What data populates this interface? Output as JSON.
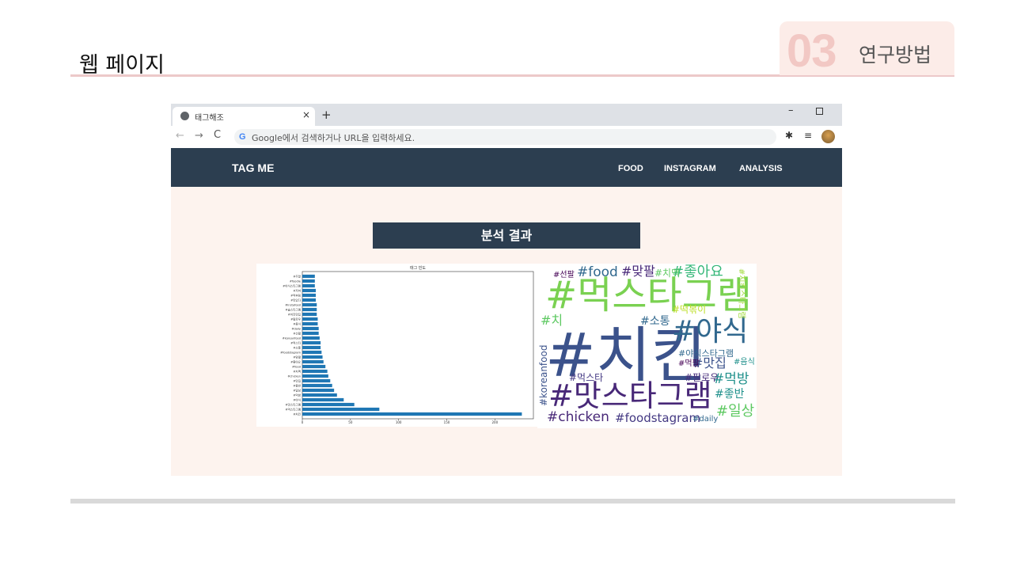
{
  "slide": {
    "title": "웹 페이지",
    "section_number": "03",
    "section_label": "연구방법"
  },
  "browser": {
    "tab_title": "태그해조",
    "tab_close": "×",
    "new_tab": "+",
    "minimize": "–",
    "back": "←",
    "forward": "→",
    "reload": "C",
    "google_g": "G",
    "address_placeholder": "Google에서 검색하거나 URL을 입력하세요.",
    "icons": [
      "globe-icon",
      "puzzle-icon",
      "queue-icon",
      "avatar"
    ]
  },
  "site": {
    "brand": "TAG ME",
    "nav": [
      "FOOD",
      "INSTAGRAM",
      "ANALYSIS"
    ],
    "result_heading": "분석 결과"
  },
  "chart_data": {
    "type": "bar",
    "orientation": "horizontal",
    "title": "태그 빈도",
    "categories": [
      "#치킨",
      "#먹스타그램",
      "#맛스타그램",
      "#야식",
      "#먹방",
      "#일상",
      "#좋반",
      "#맛집",
      "#chicken",
      "#치맥",
      "#food",
      "#좋아요",
      "#맞팔",
      "#foodstagram",
      "#소통",
      "#먹스타",
      "#koreanfood",
      "#선팔",
      "#daily",
      "#음식",
      "#팔로우",
      "#치킨맛집",
      "#술스타그램",
      "#instafood",
      "#맛있다",
      "#먹부림",
      "#저녁",
      "#야식스타그램",
      "#foodie",
      "#주말"
    ],
    "values": [
      228,
      80,
      54,
      43,
      36,
      33,
      31,
      29,
      27,
      26,
      24,
      22,
      21,
      20,
      19,
      19,
      18,
      17,
      17,
      16,
      16,
      15,
      15,
      15,
      14,
      14,
      14,
      13,
      13,
      13
    ],
    "xticks": [
      0,
      50,
      100,
      150,
      200
    ],
    "xlim": [
      0,
      240
    ],
    "bar_color": "#1f77b4",
    "grid": false
  },
  "wordcloud": {
    "words": [
      {
        "text": "#먹스타그램",
        "c": "#7ad151"
      },
      {
        "text": "#치킨",
        "c": "#3b528b"
      },
      {
        "text": "#맛스타그램",
        "c": "#482878"
      },
      {
        "text": "#야식",
        "c": "#31688e"
      },
      {
        "text": "#food",
        "c": "#31688e"
      },
      {
        "text": "#좋아요",
        "c": "#35b779"
      },
      {
        "text": "#맞팔",
        "c": "#482878"
      },
      {
        "text": "#chicken",
        "c": "#482878"
      },
      {
        "text": "#foodstagram",
        "c": "#443983"
      },
      {
        "text": "#일상",
        "c": "#5ec962"
      },
      {
        "text": "#먹방",
        "c": "#21918c"
      },
      {
        "text": "#맛집",
        "c": "#3b528b"
      },
      {
        "text": "#좋반",
        "c": "#21918c"
      },
      {
        "text": "#koreanfood",
        "c": "#3b528b"
      },
      {
        "text": "#소통",
        "c": "#31688e"
      },
      {
        "text": "#먹스타",
        "c": "#443983"
      },
      {
        "text": "#팔로우",
        "c": "#472d7b"
      },
      {
        "text": "#야식스타그램",
        "c": "#31688e"
      },
      {
        "text": "#daily",
        "c": "#31688e"
      },
      {
        "text": "#선팔",
        "c": "#440154"
      },
      {
        "text": "#치맥",
        "c": "#5ec962"
      },
      {
        "text": "#떡볶이",
        "c": "#bddf26"
      },
      {
        "text": "#음식",
        "c": "#21918c"
      },
      {
        "text": "#치킨스타그램",
        "c": "#a0da39"
      },
      {
        "text": "#먹팔",
        "c": "#440154"
      },
      {
        "text": "#치",
        "c": "#5ec962"
      }
    ]
  }
}
